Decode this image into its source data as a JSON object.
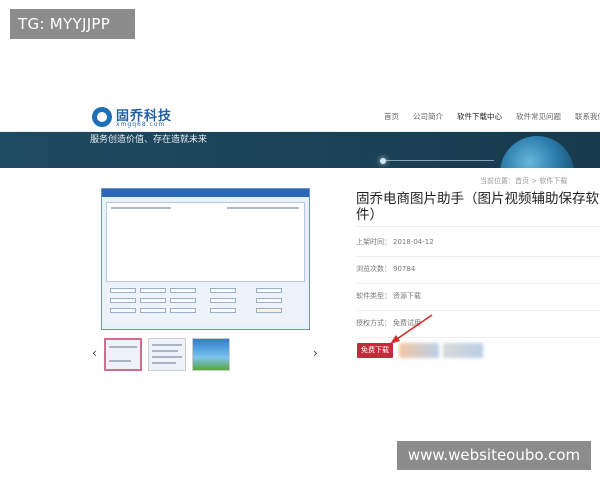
{
  "watermarks": {
    "top": "TG: MYYJJPP",
    "bottom": "www.websiteoubo.com"
  },
  "header": {
    "logo_name": "固乔科技",
    "logo_sub": "xmgq68.com",
    "nav": [
      "首页",
      "公司简介",
      "软件下载中心",
      "软件常见问题",
      "联系我们"
    ]
  },
  "banner": {
    "slogan": "服务创造价值、存在造就未来"
  },
  "breadcrumb": "当前位置：首页 > 软件下载",
  "product": {
    "title": "固乔电商图片助手（图片视频辅助保存软件）",
    "rows": [
      {
        "key": "上架时间：",
        "value": "2018-04-12"
      },
      {
        "key": "浏览次数：",
        "value": "90784"
      },
      {
        "key": "软件类型：",
        "value": "资源下载"
      },
      {
        "key": "授权方式：",
        "value": "免费试用"
      }
    ],
    "download_label": "免费下载"
  },
  "gallery": {
    "prev": "‹",
    "next": "›"
  },
  "colors": {
    "brand": "#1f5fa3",
    "banner": "#1c4357",
    "download": "#c62b3b",
    "thumb_selected": "#d26c8a"
  }
}
